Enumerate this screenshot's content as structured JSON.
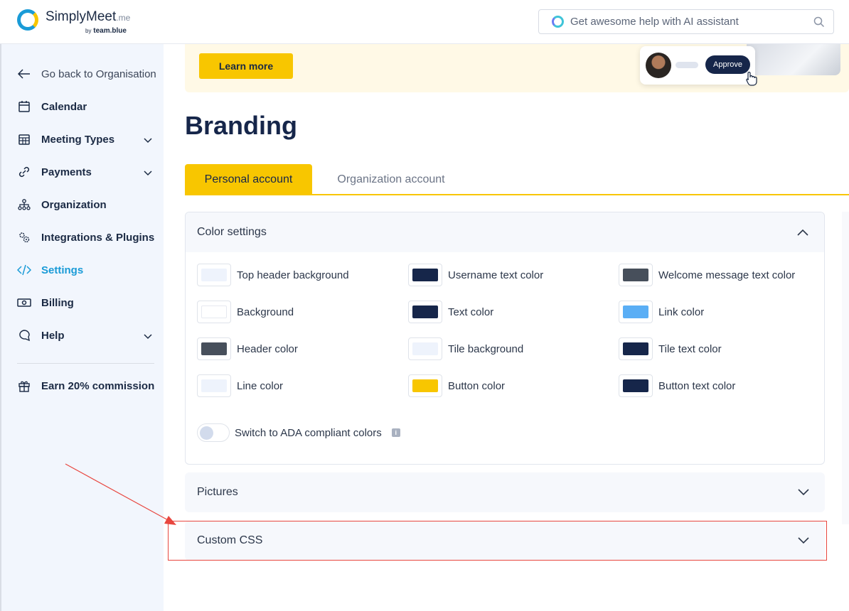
{
  "brand": {
    "name": "SimplyMeet",
    "suffix": ".me",
    "by_prefix": "by",
    "by_name": "team.blue"
  },
  "search": {
    "placeholder": "Get awesome help with AI assistant"
  },
  "sidebar": {
    "items": [
      {
        "label": "Go back to Organisation",
        "icon": "arrow-left-icon"
      },
      {
        "label": "Calendar",
        "icon": "calendar-icon"
      },
      {
        "label": "Meeting Types",
        "icon": "grid-calendar-icon"
      },
      {
        "label": "Payments",
        "icon": "link-icon"
      },
      {
        "label": "Organization",
        "icon": "org-chart-icon"
      },
      {
        "label": "Integrations & Plugins",
        "icon": "gears-icon"
      },
      {
        "label": "Settings",
        "icon": "code-icon"
      },
      {
        "label": "Billing",
        "icon": "money-icon"
      },
      {
        "label": "Help",
        "icon": "chat-icon"
      },
      {
        "label": "Earn 20% commission",
        "icon": "gift-icon"
      }
    ]
  },
  "banner": {
    "button_label": "Learn more",
    "approve_label": "Approve"
  },
  "page": {
    "title": "Branding"
  },
  "tabs": [
    {
      "label": "Personal account",
      "active": true
    },
    {
      "label": "Organization account",
      "active": false
    }
  ],
  "color_settings": {
    "title": "Color settings",
    "items": [
      {
        "label": "Top header background",
        "color": "#eef3fc"
      },
      {
        "label": "Username text color",
        "color": "#16264a"
      },
      {
        "label": "Welcome message text color",
        "color": "#474f5b"
      },
      {
        "label": "Background",
        "color": "#ffffff"
      },
      {
        "label": "Text color",
        "color": "#16264a"
      },
      {
        "label": "Link color",
        "color": "#5aaef5"
      },
      {
        "label": "Header color",
        "color": "#474f5b"
      },
      {
        "label": "Tile background",
        "color": "#eef3fc"
      },
      {
        "label": "Tile text color",
        "color": "#16264a"
      },
      {
        "label": "Line color",
        "color": "#eef3fc"
      },
      {
        "label": "Button color",
        "color": "#f8c600"
      },
      {
        "label": "Button text color",
        "color": "#16264a"
      }
    ],
    "toggle_label": "Switch to ADA compliant colors",
    "info_glyph": "i"
  },
  "sections": {
    "pictures": "Pictures",
    "custom_css": "Custom CSS"
  },
  "colors": {
    "accent_yellow": "#f8c600",
    "active_blue": "#1a9bd7",
    "navy": "#16264a",
    "annotation_red": "#e8463f"
  }
}
